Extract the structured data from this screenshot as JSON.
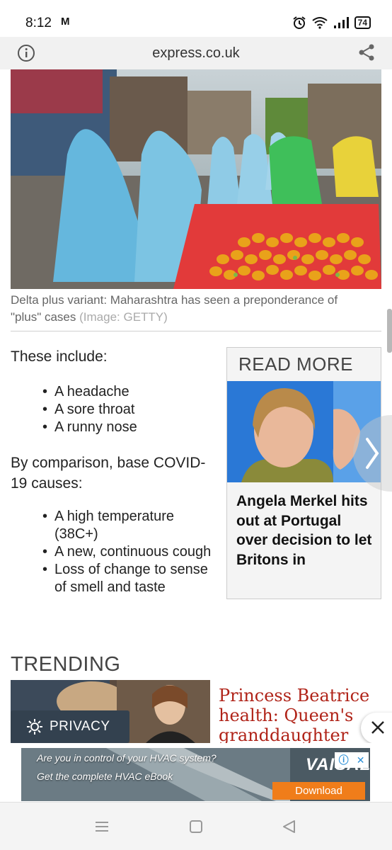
{
  "status_bar": {
    "time": "8:12",
    "mail_icon": "M",
    "battery": "74"
  },
  "browser": {
    "url": "express.co.uk"
  },
  "article": {
    "caption": "Delta plus variant: Maharashtra has seen a preponderance of \"plus\" cases",
    "credit": "(Image: GETTY)",
    "intro_1": "These include:",
    "list_1": [
      "A headache",
      "A sore throat",
      "A runny nose"
    ],
    "intro_2": "By comparison, base COVID-19 causes:",
    "list_2": [
      "A high temperature (38C+)",
      "A new, continuous cough",
      "Loss of change to sense of smell and taste"
    ]
  },
  "read_more": {
    "title": "READ MORE",
    "headline": "Angela Merkel hits out at Portugal over decision to let Britons in"
  },
  "trending": {
    "title": "TRENDING",
    "headline": "Princess Beatrice health: Queen's granddaughter"
  },
  "privacy": {
    "label": "PRIVACY"
  },
  "ad": {
    "question": "Are you in control of your HVAC system?",
    "sub": "Get the complete HVAC eBook",
    "brand": "VAISALA",
    "cta": "Download"
  },
  "colors": {
    "headline_red": "#b02318",
    "privacy_bg": "#33414f",
    "ad_cta": "#f07d1a"
  }
}
